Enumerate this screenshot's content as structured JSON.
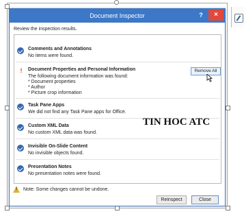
{
  "dialog": {
    "title": "Document Inspector",
    "help_label": "?",
    "close_label": "×",
    "review_text": "Review the inspection results."
  },
  "items": [
    {
      "status": "passed",
      "icon": "check-circle-icon",
      "title": "Comments and Annotations",
      "lines": [
        "No items were found."
      ]
    },
    {
      "status": "warning",
      "icon": "exclamation-icon",
      "title": "Document Properties and Personal Information",
      "lines": [
        "The following document information was found:",
        "* Document properties",
        "* Author",
        "* Picture crop information"
      ]
    },
    {
      "status": "passed",
      "icon": "check-circle-icon",
      "title": "Task Pane Apps",
      "lines": [
        "We did not find any Task Pane apps for Office."
      ]
    },
    {
      "status": "passed",
      "icon": "check-circle-icon",
      "title": "Custom XML Data",
      "lines": [
        "No custom XML data was found."
      ]
    },
    {
      "status": "passed",
      "icon": "check-circle-icon",
      "title": "Invisible On-Slide Content",
      "lines": [
        "No invisible objects found."
      ]
    },
    {
      "status": "passed",
      "icon": "check-circle-icon",
      "title": "Presentation Notes",
      "lines": [
        "No presentation notes were found."
      ]
    }
  ],
  "remove_all_label": "Remove All",
  "watermark": "TIN HOC ATC",
  "note": {
    "icon": "warning-triangle-icon",
    "text": "Note: Some changes cannot be undone."
  },
  "buttons": {
    "reinspect": "Reinspect",
    "close": "Close"
  },
  "colors": {
    "titlebar": "#3d78c8",
    "close_button": "#e0493c",
    "check": "#3468b2",
    "warning": "#d44a1f",
    "note_icon": "#e4b02b"
  }
}
